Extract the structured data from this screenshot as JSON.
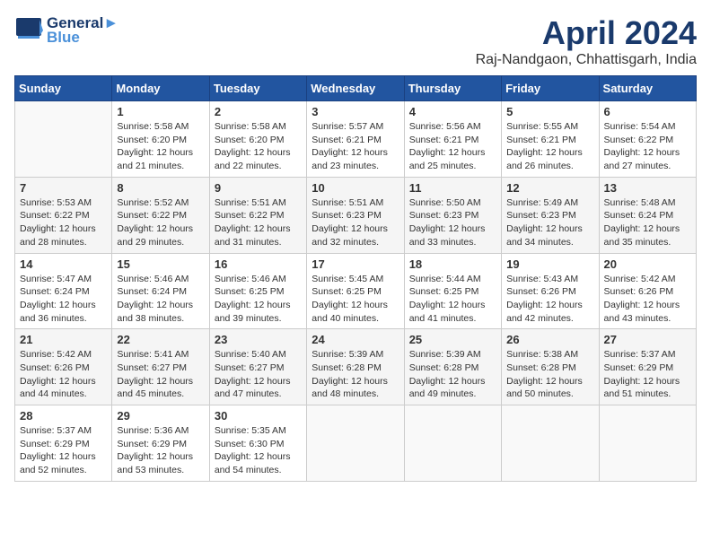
{
  "header": {
    "logo": {
      "line1": "General",
      "line2": "Blue"
    },
    "title": "April 2024",
    "location": "Raj-Nandgaon, Chhattisgarh, India"
  },
  "days_of_week": [
    "Sunday",
    "Monday",
    "Tuesday",
    "Wednesday",
    "Thursday",
    "Friday",
    "Saturday"
  ],
  "weeks": [
    [
      {
        "day": "",
        "info": ""
      },
      {
        "day": "1",
        "info": "Sunrise: 5:58 AM\nSunset: 6:20 PM\nDaylight: 12 hours\nand 21 minutes."
      },
      {
        "day": "2",
        "info": "Sunrise: 5:58 AM\nSunset: 6:20 PM\nDaylight: 12 hours\nand 22 minutes."
      },
      {
        "day": "3",
        "info": "Sunrise: 5:57 AM\nSunset: 6:21 PM\nDaylight: 12 hours\nand 23 minutes."
      },
      {
        "day": "4",
        "info": "Sunrise: 5:56 AM\nSunset: 6:21 PM\nDaylight: 12 hours\nand 25 minutes."
      },
      {
        "day": "5",
        "info": "Sunrise: 5:55 AM\nSunset: 6:21 PM\nDaylight: 12 hours\nand 26 minutes."
      },
      {
        "day": "6",
        "info": "Sunrise: 5:54 AM\nSunset: 6:22 PM\nDaylight: 12 hours\nand 27 minutes."
      }
    ],
    [
      {
        "day": "7",
        "info": "Sunrise: 5:53 AM\nSunset: 6:22 PM\nDaylight: 12 hours\nand 28 minutes."
      },
      {
        "day": "8",
        "info": "Sunrise: 5:52 AM\nSunset: 6:22 PM\nDaylight: 12 hours\nand 29 minutes."
      },
      {
        "day": "9",
        "info": "Sunrise: 5:51 AM\nSunset: 6:22 PM\nDaylight: 12 hours\nand 31 minutes."
      },
      {
        "day": "10",
        "info": "Sunrise: 5:51 AM\nSunset: 6:23 PM\nDaylight: 12 hours\nand 32 minutes."
      },
      {
        "day": "11",
        "info": "Sunrise: 5:50 AM\nSunset: 6:23 PM\nDaylight: 12 hours\nand 33 minutes."
      },
      {
        "day": "12",
        "info": "Sunrise: 5:49 AM\nSunset: 6:23 PM\nDaylight: 12 hours\nand 34 minutes."
      },
      {
        "day": "13",
        "info": "Sunrise: 5:48 AM\nSunset: 6:24 PM\nDaylight: 12 hours\nand 35 minutes."
      }
    ],
    [
      {
        "day": "14",
        "info": "Sunrise: 5:47 AM\nSunset: 6:24 PM\nDaylight: 12 hours\nand 36 minutes."
      },
      {
        "day": "15",
        "info": "Sunrise: 5:46 AM\nSunset: 6:24 PM\nDaylight: 12 hours\nand 38 minutes."
      },
      {
        "day": "16",
        "info": "Sunrise: 5:46 AM\nSunset: 6:25 PM\nDaylight: 12 hours\nand 39 minutes."
      },
      {
        "day": "17",
        "info": "Sunrise: 5:45 AM\nSunset: 6:25 PM\nDaylight: 12 hours\nand 40 minutes."
      },
      {
        "day": "18",
        "info": "Sunrise: 5:44 AM\nSunset: 6:25 PM\nDaylight: 12 hours\nand 41 minutes."
      },
      {
        "day": "19",
        "info": "Sunrise: 5:43 AM\nSunset: 6:26 PM\nDaylight: 12 hours\nand 42 minutes."
      },
      {
        "day": "20",
        "info": "Sunrise: 5:42 AM\nSunset: 6:26 PM\nDaylight: 12 hours\nand 43 minutes."
      }
    ],
    [
      {
        "day": "21",
        "info": "Sunrise: 5:42 AM\nSunset: 6:26 PM\nDaylight: 12 hours\nand 44 minutes."
      },
      {
        "day": "22",
        "info": "Sunrise: 5:41 AM\nSunset: 6:27 PM\nDaylight: 12 hours\nand 45 minutes."
      },
      {
        "day": "23",
        "info": "Sunrise: 5:40 AM\nSunset: 6:27 PM\nDaylight: 12 hours\nand 47 minutes."
      },
      {
        "day": "24",
        "info": "Sunrise: 5:39 AM\nSunset: 6:28 PM\nDaylight: 12 hours\nand 48 minutes."
      },
      {
        "day": "25",
        "info": "Sunrise: 5:39 AM\nSunset: 6:28 PM\nDaylight: 12 hours\nand 49 minutes."
      },
      {
        "day": "26",
        "info": "Sunrise: 5:38 AM\nSunset: 6:28 PM\nDaylight: 12 hours\nand 50 minutes."
      },
      {
        "day": "27",
        "info": "Sunrise: 5:37 AM\nSunset: 6:29 PM\nDaylight: 12 hours\nand 51 minutes."
      }
    ],
    [
      {
        "day": "28",
        "info": "Sunrise: 5:37 AM\nSunset: 6:29 PM\nDaylight: 12 hours\nand 52 minutes."
      },
      {
        "day": "29",
        "info": "Sunrise: 5:36 AM\nSunset: 6:29 PM\nDaylight: 12 hours\nand 53 minutes."
      },
      {
        "day": "30",
        "info": "Sunrise: 5:35 AM\nSunset: 6:30 PM\nDaylight: 12 hours\nand 54 minutes."
      },
      {
        "day": "",
        "info": ""
      },
      {
        "day": "",
        "info": ""
      },
      {
        "day": "",
        "info": ""
      },
      {
        "day": "",
        "info": ""
      }
    ]
  ]
}
